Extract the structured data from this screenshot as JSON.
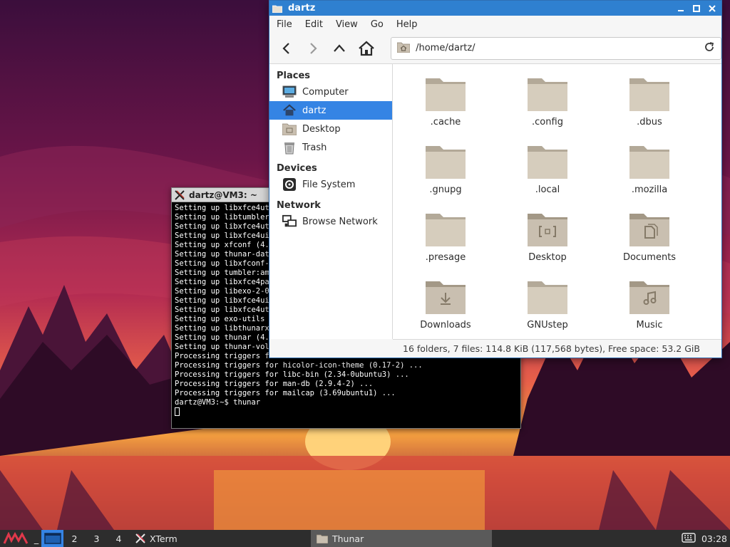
{
  "terminal": {
    "title": "dartz@VM3: ~",
    "lines": [
      "Setting up libxfce4uti",
      "Setting up libtumbler-",
      "Setting up libxfce4uti",
      "Setting up libxfce4ui-",
      "Setting up xfconf (4.1",
      "Setting up thunar-data",
      "Setting up libxfconf-0",
      "Setting up tumbler:amd",
      "Setting up libxfce4par",
      "Setting up libexo-2-0:",
      "Setting up libxfce4ui-",
      "Setting up libxfce4uti",
      "Setting up exo-utils (",
      "Setting up libthunarx-",
      "Setting up thunar (4.1",
      "Setting up thunar-volm",
      "Processing triggers fo",
      "Processing triggers for hicolor-icon-theme (0.17-2) ...",
      "Processing triggers for libc-bin (2.34-0ubuntu3) ...",
      "Processing triggers for man-db (2.9.4-2) ...",
      "Processing triggers for mailcap (3.69ubuntu1) ...",
      "dartz@VM3:~$ thunar"
    ]
  },
  "thunar": {
    "title": "dartz",
    "menu": [
      "File",
      "Edit",
      "View",
      "Go",
      "Help"
    ],
    "location": "/home/dartz/",
    "sidebar": {
      "places_heading": "Places",
      "places": [
        {
          "label": "Computer",
          "icon": "computer-icon"
        },
        {
          "label": "dartz",
          "icon": "home-icon",
          "selected": true
        },
        {
          "label": "Desktop",
          "icon": "desktop-folder-icon"
        },
        {
          "label": "Trash",
          "icon": "trash-icon"
        }
      ],
      "devices_heading": "Devices",
      "devices": [
        {
          "label": "File System",
          "icon": "drive-icon"
        }
      ],
      "network_heading": "Network",
      "network": [
        {
          "label": "Browse Network",
          "icon": "network-icon"
        }
      ]
    },
    "files": [
      {
        "name": ".cache",
        "emblem": ""
      },
      {
        "name": ".config",
        "emblem": ""
      },
      {
        "name": ".dbus",
        "emblem": ""
      },
      {
        "name": ".gnupg",
        "emblem": ""
      },
      {
        "name": ".local",
        "emblem": ""
      },
      {
        "name": ".mozilla",
        "emblem": ""
      },
      {
        "name": ".presage",
        "emblem": ""
      },
      {
        "name": "Desktop",
        "emblem": "desktop"
      },
      {
        "name": "Documents",
        "emblem": "documents"
      },
      {
        "name": "Downloads",
        "emblem": "downloads"
      },
      {
        "name": "GNUstep",
        "emblem": ""
      },
      {
        "name": "Music",
        "emblem": "music"
      }
    ],
    "status": "16 folders, 7 files: 114.8 KiB (117,568 bytes), Free space: 53.2 GiB"
  },
  "taskbar": {
    "minimize_label": "_",
    "workspaces": [
      "2",
      "3",
      "4"
    ],
    "tasks": [
      {
        "label": "XTerm",
        "icon": "xterm-icon"
      },
      {
        "label": "Thunar",
        "icon": "folder-icon",
        "active": true
      }
    ],
    "clock": "03:28"
  },
  "colors": {
    "accent": "#3584e4",
    "titlebar": "#2f80d0",
    "folder": "#c9bfb0"
  }
}
